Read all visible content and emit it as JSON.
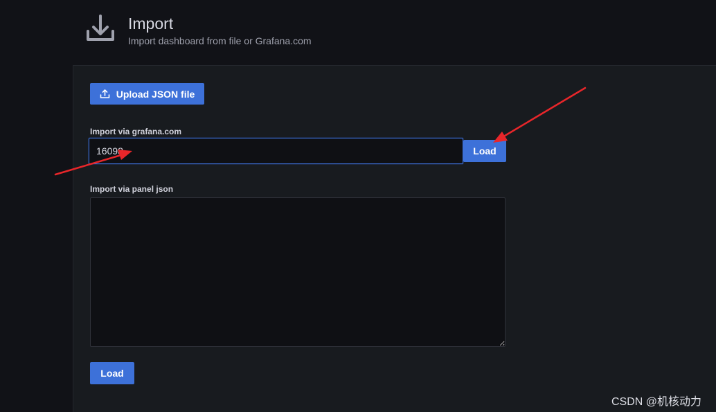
{
  "header": {
    "title": "Import",
    "subtitle": "Import dashboard from file or Grafana.com",
    "icon": "download-icon"
  },
  "upload": {
    "label": "Upload JSON file",
    "icon": "upload-icon"
  },
  "grafana_com": {
    "label": "Import via grafana.com",
    "value": "16098",
    "load_label": "Load"
  },
  "panel_json": {
    "label": "Import via panel json",
    "value": "",
    "load_label": "Load"
  },
  "watermark": "CSDN @机核动力",
  "colors": {
    "accent": "#3d71d9",
    "annotation_arrow": "#e8262a",
    "background": "#111217",
    "panel": "#181b1f"
  }
}
